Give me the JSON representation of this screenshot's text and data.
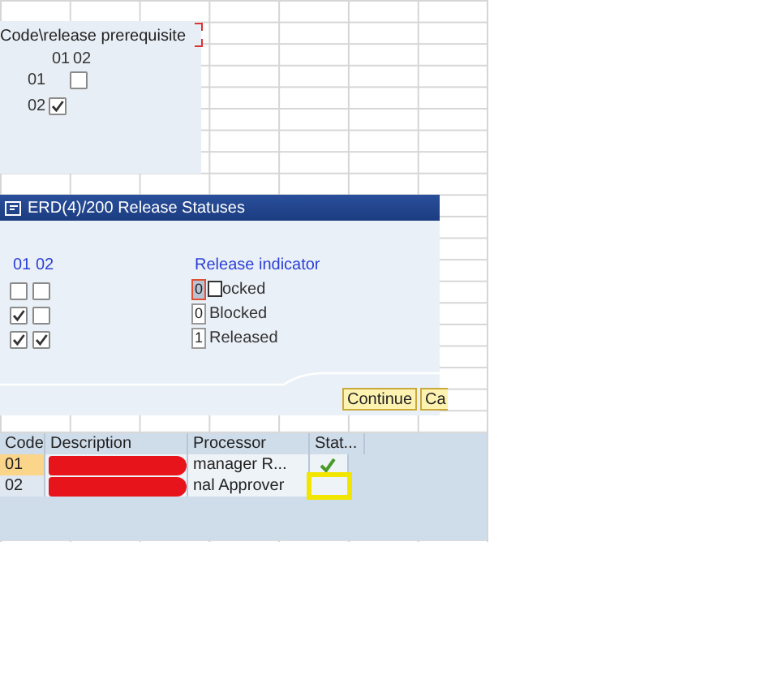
{
  "prerequisite_panel": {
    "title": "Code\\release prerequisite",
    "columns": [
      "01",
      "02"
    ],
    "rows": [
      {
        "code": "01",
        "cells": [
          {
            "kind": "empty"
          },
          {
            "kind": "checkbox",
            "checked": false
          }
        ]
      },
      {
        "code": "02",
        "cells": [
          {
            "kind": "checkbox",
            "checked": true
          },
          {
            "kind": "empty"
          }
        ]
      }
    ]
  },
  "dialog": {
    "title": "ERD(4)/200 Release Statuses",
    "columns": [
      "01",
      "02"
    ],
    "indicator_header": "Release indicator",
    "rows": [
      {
        "checks": [
          false,
          false
        ],
        "indicator": "0",
        "label": "ocked",
        "focused": true
      },
      {
        "checks": [
          true,
          false
        ],
        "indicator": "0",
        "label": "Blocked",
        "focused": false
      },
      {
        "checks": [
          true,
          true
        ],
        "indicator": "1",
        "label": "Released",
        "focused": false
      }
    ],
    "buttons": [
      "Continue",
      "Ca"
    ]
  },
  "table": {
    "columns": [
      "Code",
      "Description",
      "Processor",
      "Stat..."
    ],
    "rows": [
      {
        "code": "01",
        "selected": true,
        "redacted": true,
        "processor": "manager R...",
        "status_ok": true,
        "highlighted": false
      },
      {
        "code": "02",
        "selected": false,
        "redacted": true,
        "processor": "nal Approver",
        "status_ok": false,
        "highlighted": true
      }
    ]
  }
}
